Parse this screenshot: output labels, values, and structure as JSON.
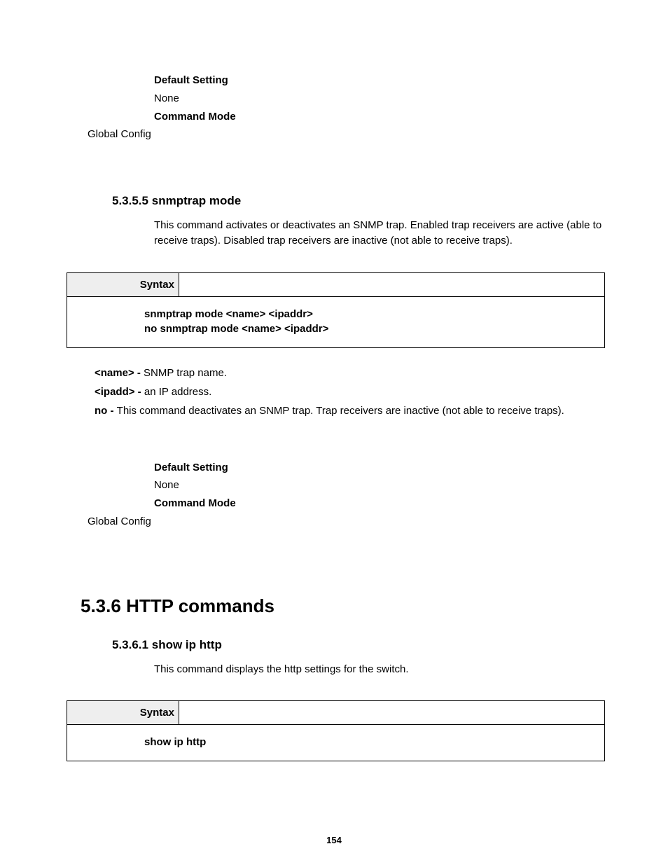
{
  "block1": {
    "default_setting_label": "Default Setting",
    "default_setting_value": "None",
    "command_mode_label": "Command Mode",
    "command_mode_value": "Global Config"
  },
  "sec_5355": {
    "heading_num": "5.3.5.5",
    "heading_title": "snmptrap mode",
    "description": "This command activates or deactivates an SNMP trap. Enabled trap receivers are active (able to receive traps). Disabled trap receivers are inactive (not able to receive traps).",
    "syntax_label": "Syntax",
    "syntax_lines": {
      "l1": "snmptrap mode <name> <ipaddr>",
      "l2": "no snmptrap mode <name> <ipaddr>"
    },
    "params": {
      "p1_name": "<name> - ",
      "p1_desc": "SNMP trap name.",
      "p2_name": "<ipadd> - ",
      "p2_desc": "an IP address.",
      "p3_name": "no - ",
      "p3_desc": "This command deactivates an SNMP trap. Trap receivers are inactive (not able to receive traps)."
    },
    "default_setting_label": "Default Setting",
    "default_setting_value": "None",
    "command_mode_label": "Command Mode",
    "command_mode_value": "Global Config"
  },
  "sec_536": {
    "heading_num": "5.3.6",
    "heading_title": "HTTP commands"
  },
  "sec_5361": {
    "heading_num": "5.3.6.1",
    "heading_title": "show ip http",
    "description": "This command displays the http settings for the switch.",
    "syntax_label": "Syntax",
    "syntax_lines": {
      "l1": "show ip http"
    }
  },
  "page_number": "154"
}
